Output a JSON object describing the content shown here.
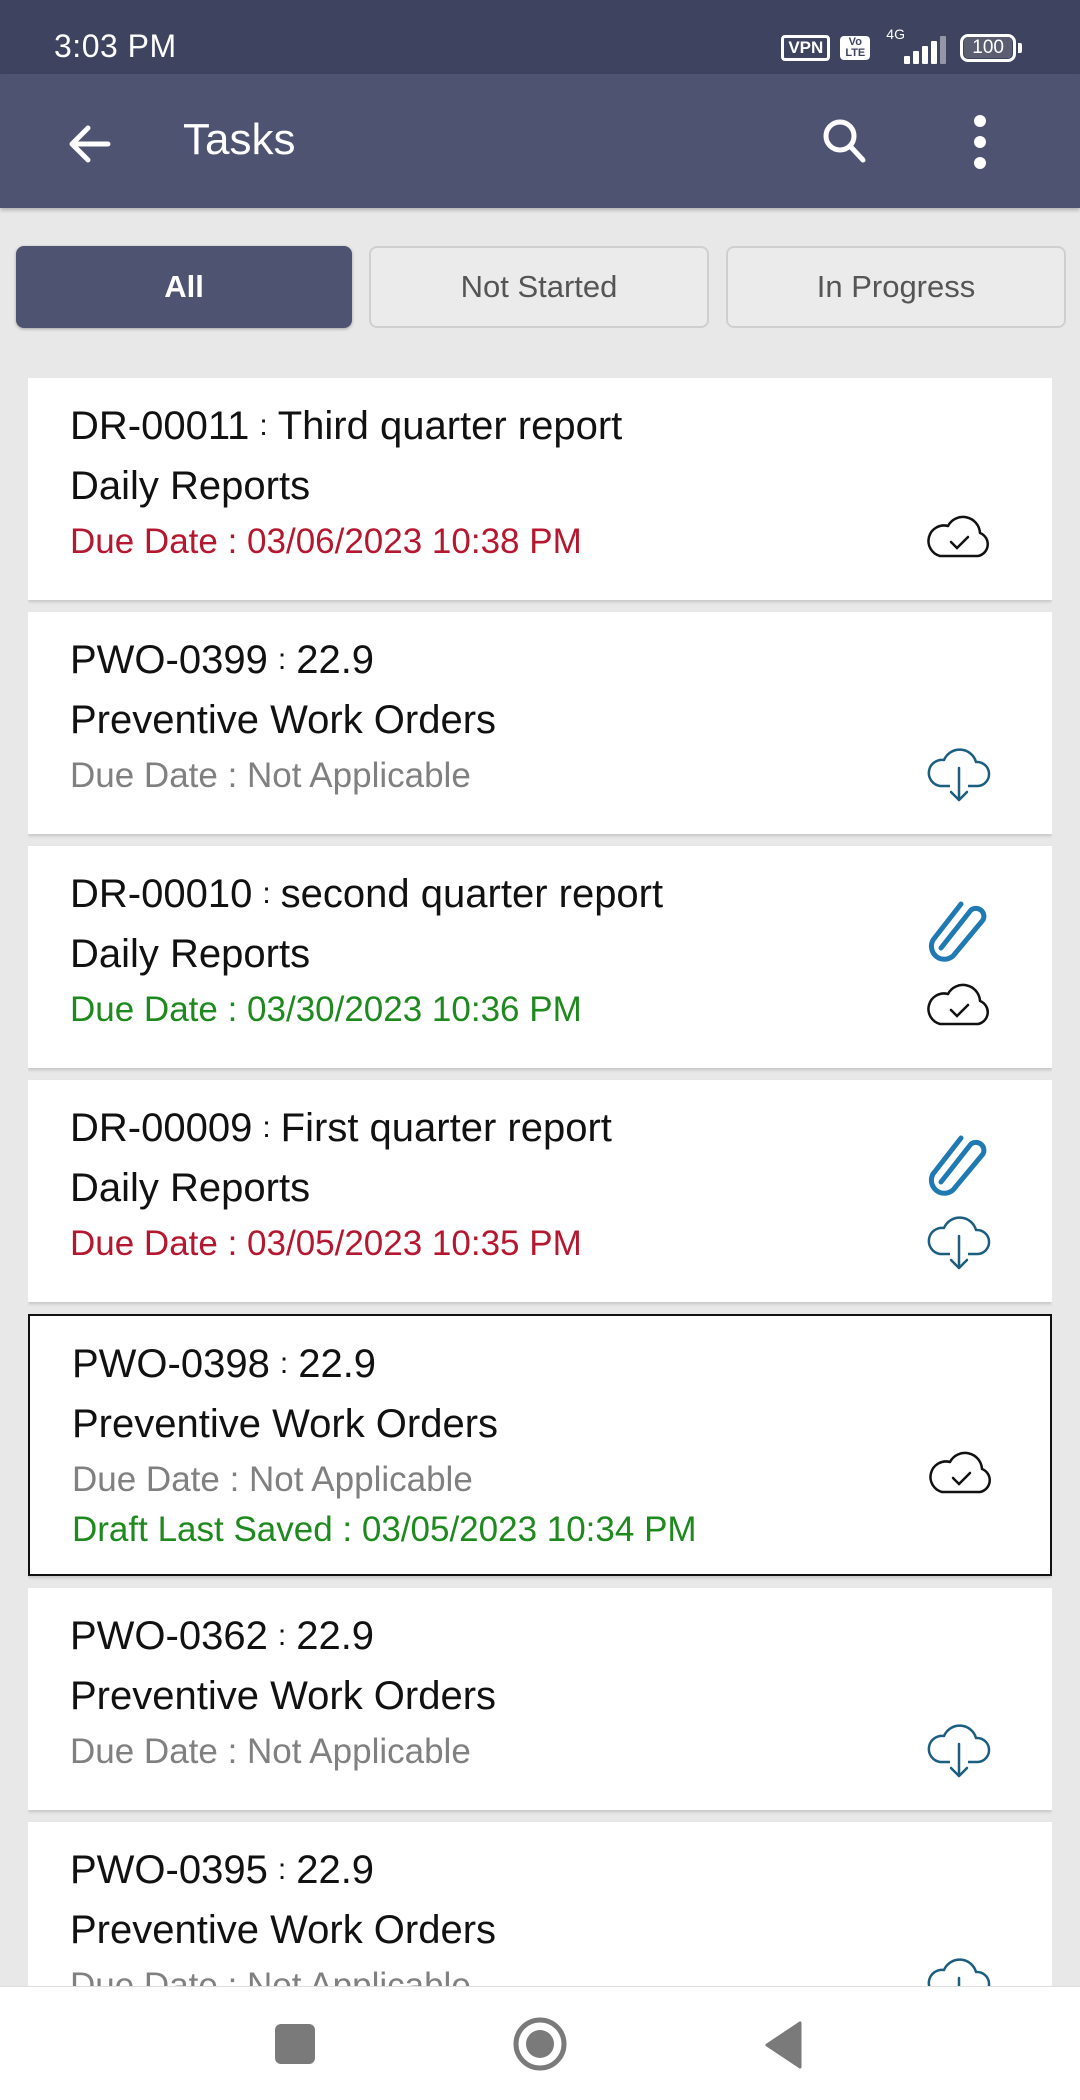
{
  "status_bar": {
    "time": "3:03 PM",
    "vpn_label": "VPN",
    "volte_label_top": "Vo",
    "volte_label_bottom": "LTE",
    "network_type": "4G",
    "battery_level": "100"
  },
  "app_bar": {
    "title": "Tasks",
    "back_icon": "arrow-left",
    "search_icon": "magnifier",
    "more_icon": "vertical-ellipsis"
  },
  "filters": {
    "tabs": [
      {
        "label": "All",
        "active": true
      },
      {
        "label": "Not Started",
        "active": false
      },
      {
        "label": "In Progress",
        "active": false
      }
    ]
  },
  "colors": {
    "primary": "#4f5372",
    "status_bar": "#3e4360",
    "overdue": "#b5172f",
    "on_time": "#1e8a1e",
    "not_applicable": "#808080",
    "sync_icon": "#1b5e80"
  },
  "tasks": [
    {
      "id": "DR-00011",
      "separator": ":",
      "name": "Third quarter report",
      "category": "Daily Reports",
      "due": "Due Date : 03/06/2023 10:38 PM",
      "due_status": "overdue",
      "has_attachment": false,
      "sync_icon": "cloud-check",
      "selected": false
    },
    {
      "id": "PWO-0399",
      "separator": ":",
      "name": "22.9",
      "category": "Preventive Work Orders",
      "due": "Due Date : Not Applicable",
      "due_status": "not_applicable",
      "has_attachment": false,
      "sync_icon": "cloud-download",
      "selected": false
    },
    {
      "id": "DR-00010",
      "separator": ":",
      "name": "second quarter report",
      "category": "Daily Reports",
      "due": "Due Date : 03/30/2023 10:36 PM",
      "due_status": "on_time",
      "has_attachment": true,
      "sync_icon": "cloud-check",
      "selected": false
    },
    {
      "id": "DR-00009",
      "separator": ":",
      "name": "First quarter report",
      "category": "Daily Reports",
      "due": "Due Date : 03/05/2023 10:35 PM",
      "due_status": "overdue",
      "has_attachment": true,
      "sync_icon": "cloud-download",
      "selected": false
    },
    {
      "id": "PWO-0398",
      "separator": ":",
      "name": "22.9",
      "category": "Preventive Work Orders",
      "due": "Due Date : Not Applicable",
      "due_status": "not_applicable",
      "draft": "Draft Last Saved : 03/05/2023 10:34 PM",
      "has_attachment": false,
      "sync_icon": "cloud-check",
      "selected": true
    },
    {
      "id": "PWO-0362",
      "separator": ":",
      "name": "22.9",
      "category": "Preventive Work Orders",
      "due": "Due Date : Not Applicable",
      "due_status": "not_applicable",
      "has_attachment": false,
      "sync_icon": "cloud-download",
      "selected": false
    },
    {
      "id": "PWO-0395",
      "separator": ":",
      "name": "22.9",
      "category": "Preventive Work Orders",
      "due": "Due Date : Not Applicable",
      "due_status": "not_applicable",
      "has_attachment": false,
      "sync_icon": "cloud-download",
      "selected": false
    }
  ],
  "nav_bar": {
    "recents_icon": "square",
    "home_icon": "circle",
    "back_icon": "triangle-left"
  }
}
